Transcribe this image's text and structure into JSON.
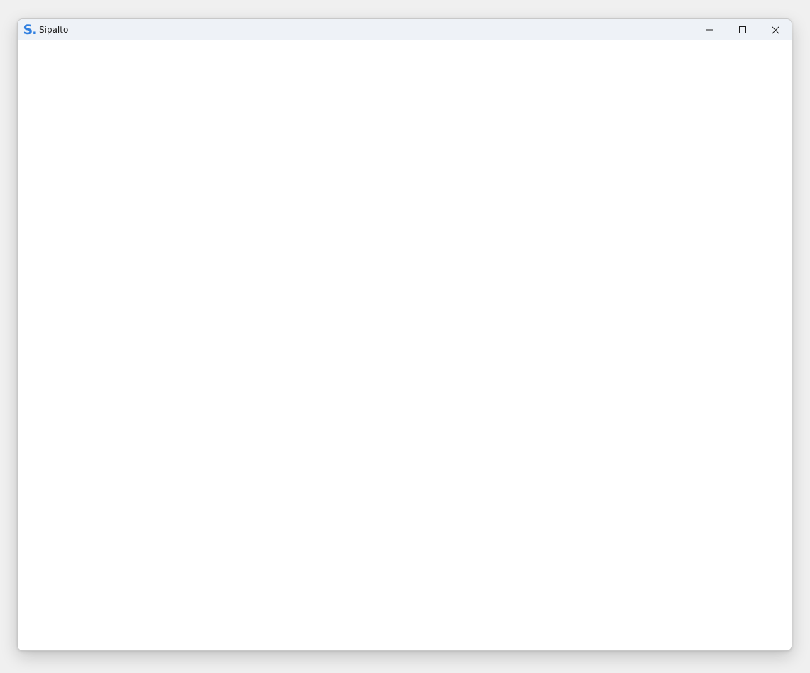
{
  "window": {
    "title": "Sipalto",
    "logo_text": "S.",
    "logo_color": "#2f7fe0",
    "titlebar_color": "#eef2f7"
  },
  "controls": {
    "minimize_icon": "minimize-icon",
    "maximize_icon": "maximize-icon",
    "close_icon": "close-icon"
  }
}
